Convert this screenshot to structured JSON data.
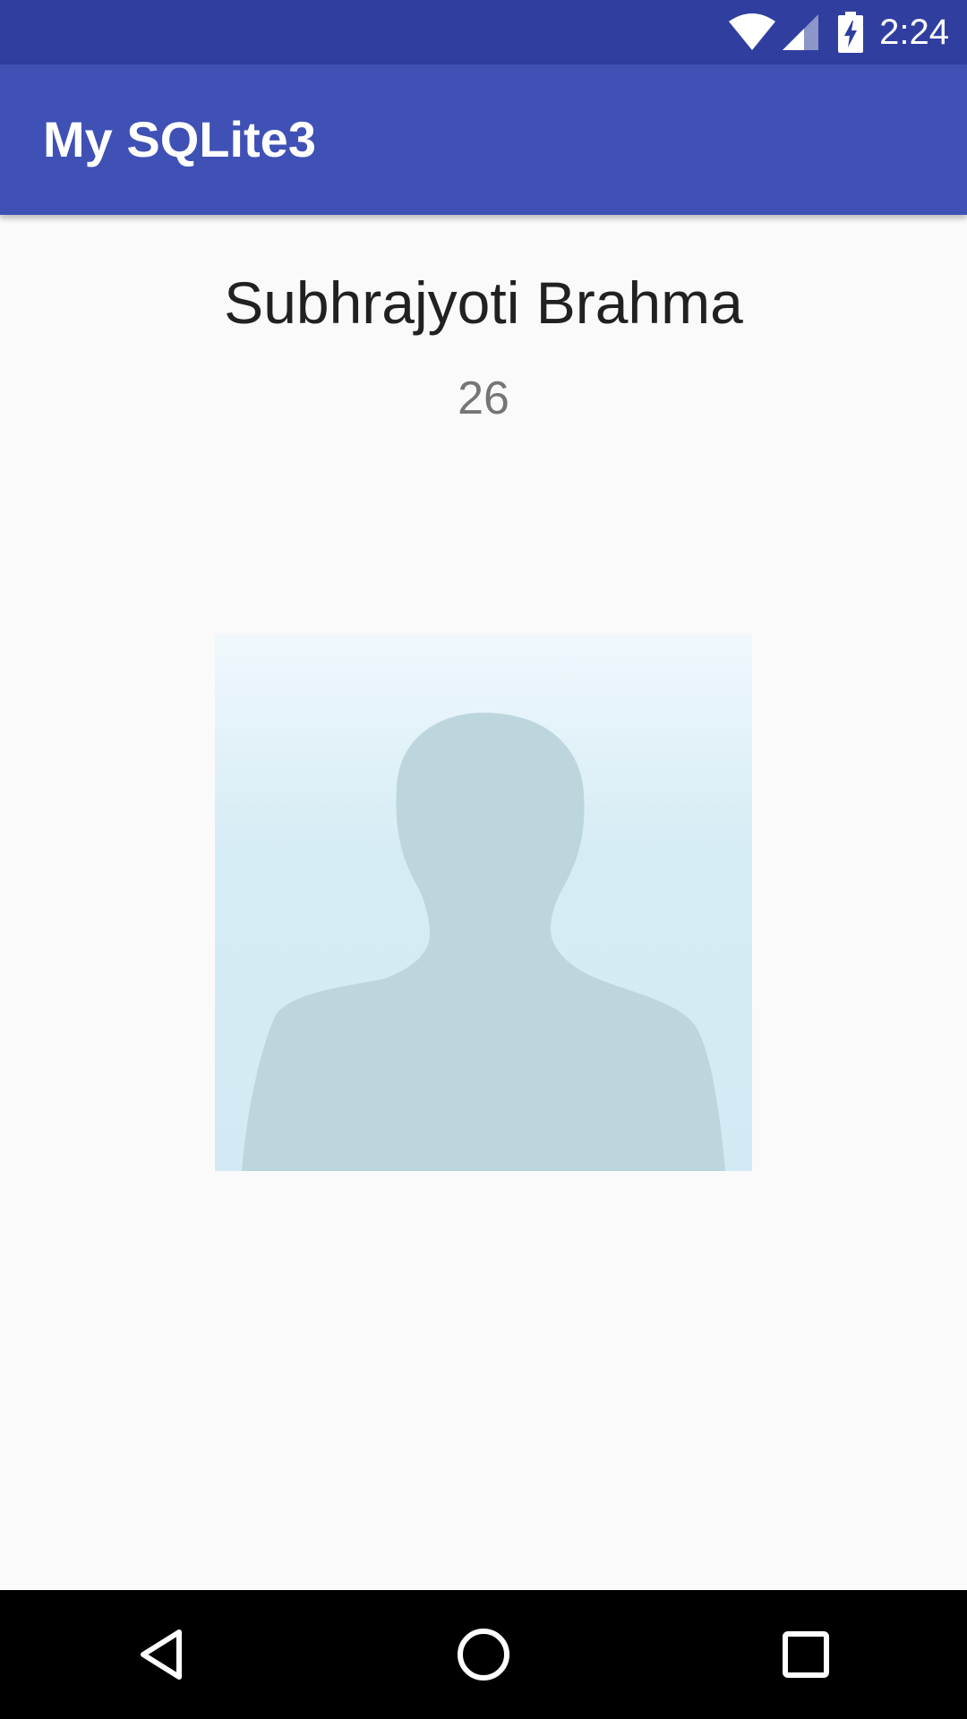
{
  "status_bar": {
    "time": "2:24",
    "icons": [
      "wifi-icon",
      "cell-signal-icon",
      "battery-charging-icon"
    ]
  },
  "app_bar": {
    "title": "My SQLite3",
    "color": "#3f51b5",
    "status_color": "#303f9f"
  },
  "profile": {
    "name": "Subhrajyoti Brahma",
    "age": "26",
    "photo_icon": "person-silhouette-icon"
  },
  "nav_bar": {
    "icons": [
      "back-icon",
      "home-icon",
      "recents-icon"
    ]
  }
}
